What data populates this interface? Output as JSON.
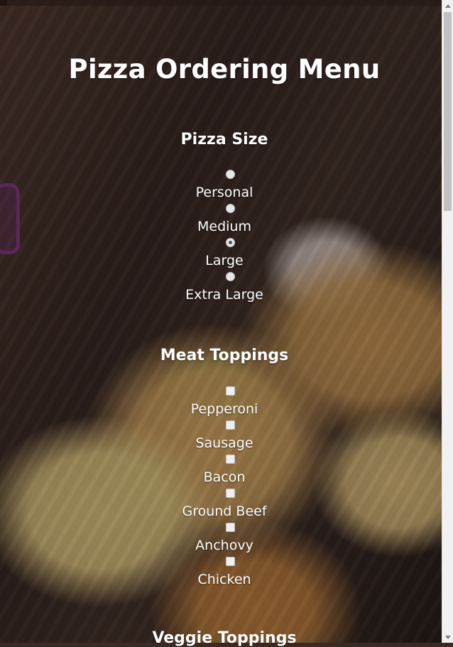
{
  "page": {
    "title": "Pizza Ordering Menu"
  },
  "sections": {
    "size": {
      "heading": "Pizza Size",
      "options": [
        {
          "label": "Personal",
          "checked": false
        },
        {
          "label": "Medium",
          "checked": false
        },
        {
          "label": "Large",
          "checked": true
        },
        {
          "label": "Extra Large",
          "checked": false
        }
      ]
    },
    "meat": {
      "heading": "Meat Toppings",
      "options": [
        {
          "label": "Pepperoni",
          "checked": false
        },
        {
          "label": "Sausage",
          "checked": false
        },
        {
          "label": "Bacon",
          "checked": false
        },
        {
          "label": "Ground Beef",
          "checked": false
        },
        {
          "label": "Anchovy",
          "checked": false
        },
        {
          "label": "Chicken",
          "checked": false
        }
      ]
    },
    "veggie": {
      "heading": "Veggie Toppings"
    }
  },
  "colors": {
    "text": "#ffffff",
    "overlay": "rgba(0,0,0,0.34)"
  }
}
